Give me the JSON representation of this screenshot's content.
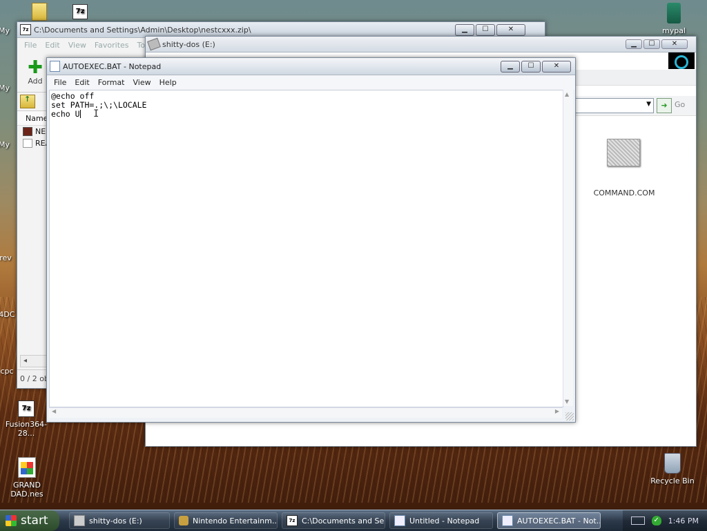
{
  "desktop": {
    "icons": [
      {
        "label": "My",
        "type": "folder"
      },
      {
        "label": "My",
        "type": "folder"
      },
      {
        "label": "My",
        "type": "folder"
      },
      {
        "label": "rev",
        "type": "file"
      },
      {
        "label": "4DC",
        "type": "file"
      },
      {
        "label": "cpc",
        "type": "file"
      },
      {
        "label": "Fusion364-28...",
        "type": "7z"
      },
      {
        "label": "GRAND DAD.nes",
        "type": "nes"
      },
      {
        "label": "mypal",
        "type": "app"
      },
      {
        "label": "Recycle Bin",
        "type": "recycle"
      }
    ],
    "zip_icon_glyph": "7z"
  },
  "zip_window": {
    "title": "C:\\Documents and Settings\\Admin\\Desktop\\nestcxxx.zip\\",
    "menu": [
      "File",
      "Edit",
      "View",
      "Favorites",
      "Tools"
    ],
    "add_label": "Add",
    "list_header": "Name",
    "rows": [
      "NE",
      "REA"
    ],
    "status": "0 / 2 ob"
  },
  "dos_window": {
    "title": "shitty-dos (E:)",
    "go_label": "Go",
    "file_label": "COMMAND.COM"
  },
  "notepad": {
    "title": "AUTOEXEC.BAT - Notepad",
    "menu": [
      "File",
      "Edit",
      "Format",
      "View",
      "Help"
    ],
    "content": "@echo off\nset PATH=.;\\;\\LOCALE\necho U"
  },
  "taskbar": {
    "start_label": "start",
    "tasks": [
      {
        "label": "shitty-dos (E:)",
        "icon": "drive-icon",
        "active": false
      },
      {
        "label": "Nintendo Entertainm...",
        "icon": "nes-icon",
        "active": false
      },
      {
        "label": "C:\\Documents and Se...",
        "icon": "7z-icon",
        "active": false
      },
      {
        "label": "Untitled - Notepad",
        "icon": "notepad-icon",
        "active": false
      },
      {
        "label": "AUTOEXEC.BAT - Not...",
        "icon": "notepad-icon",
        "active": true
      }
    ],
    "clock": "1:46 PM"
  },
  "window_buttons": {
    "minimize": "▁",
    "maximize": "☐",
    "close": "✕"
  },
  "colors": {
    "accent_go": "#2a9a2a",
    "add_plus": "#1a9a1a"
  }
}
